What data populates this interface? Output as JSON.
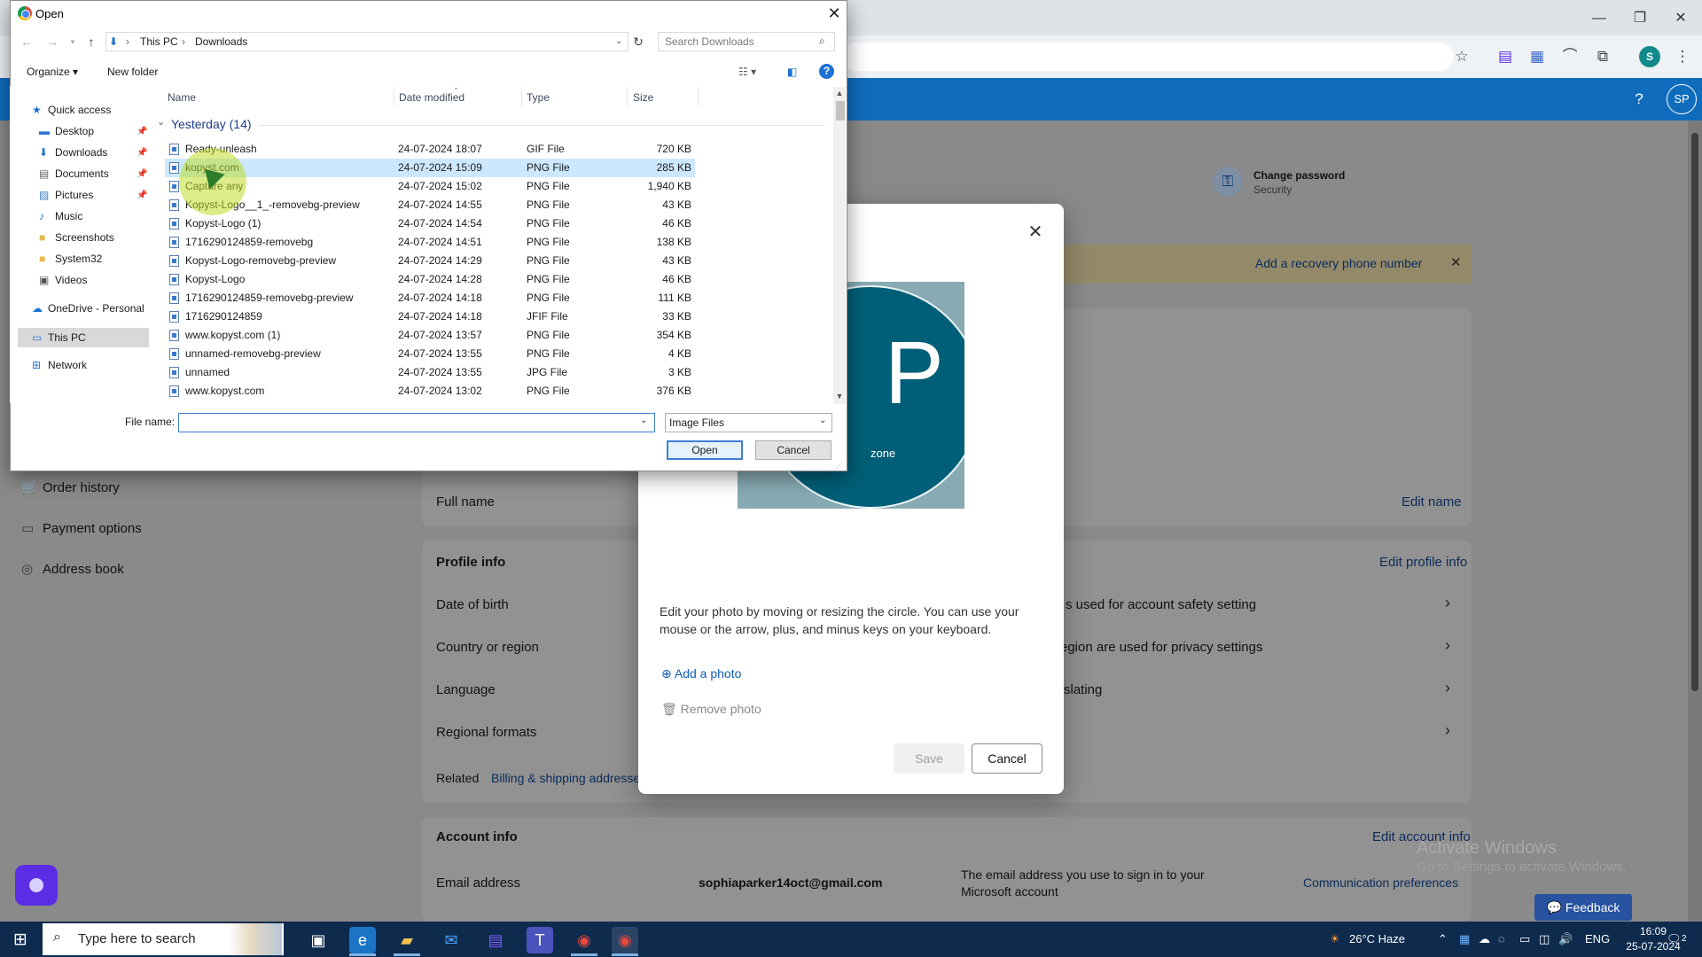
{
  "browser": {
    "minimize": "—",
    "restore": "❐",
    "close": "✕",
    "extension_icons": [
      "star-icon",
      "todo-icon",
      "docs-icon",
      "arc-icon",
      "puzzle-icon"
    ],
    "profile_letter": "S",
    "menu": "⋮"
  },
  "ms_header": {
    "help": "?",
    "avatar": "SP",
    "color": "#0f6cbd"
  },
  "sidebar": {
    "items": [
      {
        "label": "Order history",
        "icon": "cart-icon"
      },
      {
        "label": "Payment options",
        "icon": "card-icon"
      },
      {
        "label": "Address book",
        "icon": "location-icon"
      }
    ]
  },
  "security": {
    "title": "Change password",
    "subtitle": "Security"
  },
  "banner": {
    "text": "Add a recovery phone number",
    "close": "✕"
  },
  "profile": {
    "full_name_label": "Full name",
    "edit_name": "Edit name",
    "profile_info": "Profile info",
    "edit_profile_info": "Edit profile info",
    "rows": [
      {
        "label": "Date of birth",
        "value": "s used for account safety setting"
      },
      {
        "label": "Country or region",
        "value": "egion are used for privacy settings"
      },
      {
        "label": "Language",
        "value": "slating"
      },
      {
        "label": "Regional formats",
        "value": ""
      }
    ],
    "related_label": "Related",
    "related_link": "Billing & shipping addresse",
    "account_info": "Account info",
    "edit_account_info": "Edit account info",
    "email_label": "Email address",
    "email_value": "sophiaparker14oct@gmail.com",
    "email_desc": "The email address you use to sign in to your Microsoft account",
    "comm_prefs": "Communication preferences"
  },
  "watermark": {
    "line1": "Activate Windows",
    "line2": "Go to Settings to activate Windows."
  },
  "feedback": "Feedback",
  "modal": {
    "close": "✕",
    "photo_letter": "P",
    "photo_caption": "zone",
    "description": "Edit your photo by moving or resizing the circle. You can use your mouse or the arrow, plus, and minus keys on your keyboard.",
    "add_photo": "Add a photo",
    "remove_photo": "Remove photo",
    "save": "Save",
    "cancel": "Cancel"
  },
  "dialog": {
    "title": "Open",
    "close": "✕",
    "breadcrumb": [
      "This PC",
      "Downloads"
    ],
    "search_placeholder": "Search Downloads",
    "organize": "Organize ▾",
    "new_folder": "New folder",
    "help": "?",
    "nav": [
      {
        "label": "Quick access",
        "icon": "star-icon",
        "pinned": false
      },
      {
        "label": "Desktop",
        "icon": "desktop-icon",
        "pinned": true
      },
      {
        "label": "Downloads",
        "icon": "download-icon",
        "pinned": true
      },
      {
        "label": "Documents",
        "icon": "documents-icon",
        "pinned": true
      },
      {
        "label": "Pictures",
        "icon": "pictures-icon",
        "pinned": true
      },
      {
        "label": "Music",
        "icon": "music-icon",
        "pinned": false
      },
      {
        "label": "Screenshots",
        "icon": "folder-icon",
        "pinned": false
      },
      {
        "label": "System32",
        "icon": "folder-icon",
        "pinned": false
      },
      {
        "label": "Videos",
        "icon": "videos-icon",
        "pinned": false
      },
      {
        "label": "OneDrive - Personal",
        "icon": "cloud-icon",
        "pinned": false
      },
      {
        "label": "This PC",
        "icon": "pc-icon",
        "pinned": false
      },
      {
        "label": "Network",
        "icon": "network-icon",
        "pinned": false
      }
    ],
    "columns": [
      "Name",
      "Date modified",
      "Type",
      "Size"
    ],
    "group": "Yesterday (14)",
    "files": [
      {
        "name": "Ready-unleash",
        "date": "24-07-2024 18:07",
        "type": "GIF File",
        "size": "720 KB"
      },
      {
        "name": "kopyst.com",
        "date": "24-07-2024 15:09",
        "type": "PNG File",
        "size": "285 KB"
      },
      {
        "name": "Capture any",
        "date": "24-07-2024 15:02",
        "type": "PNG File",
        "size": "1,940 KB"
      },
      {
        "name": "Kopyst-Logo__1_-removebg-preview",
        "date": "24-07-2024 14:55",
        "type": "PNG File",
        "size": "43 KB"
      },
      {
        "name": "Kopyst-Logo (1)",
        "date": "24-07-2024 14:54",
        "type": "PNG File",
        "size": "46 KB"
      },
      {
        "name": "1716290124859-removebg",
        "date": "24-07-2024 14:51",
        "type": "PNG File",
        "size": "138 KB"
      },
      {
        "name": "Kopyst-Logo-removebg-preview",
        "date": "24-07-2024 14:29",
        "type": "PNG File",
        "size": "43 KB"
      },
      {
        "name": "Kopyst-Logo",
        "date": "24-07-2024 14:28",
        "type": "PNG File",
        "size": "46 KB"
      },
      {
        "name": "1716290124859-removebg-preview",
        "date": "24-07-2024 14:18",
        "type": "PNG File",
        "size": "111 KB"
      },
      {
        "name": "1716290124859",
        "date": "24-07-2024 14:18",
        "type": "JFIF File",
        "size": "33 KB"
      },
      {
        "name": "www.kopyst.com (1)",
        "date": "24-07-2024 13:57",
        "type": "PNG File",
        "size": "354 KB"
      },
      {
        "name": "unnamed-removebg-preview",
        "date": "24-07-2024 13:55",
        "type": "PNG File",
        "size": "4 KB"
      },
      {
        "name": "unnamed",
        "date": "24-07-2024 13:55",
        "type": "JPG File",
        "size": "3 KB"
      },
      {
        "name": "www.kopyst.com",
        "date": "24-07-2024 13:02",
        "type": "PNG File",
        "size": "376 KB"
      }
    ],
    "selected_index": 1,
    "file_name_label": "File name:",
    "file_name_value": "",
    "filter": "Image Files",
    "open": "Open",
    "cancel": "Cancel"
  },
  "taskbar": {
    "search_placeholder": "Type here to search",
    "weather": "26°C  Haze",
    "language": "ENG",
    "time": "16:09",
    "date": "25-07-2024",
    "notifications": "2"
  }
}
